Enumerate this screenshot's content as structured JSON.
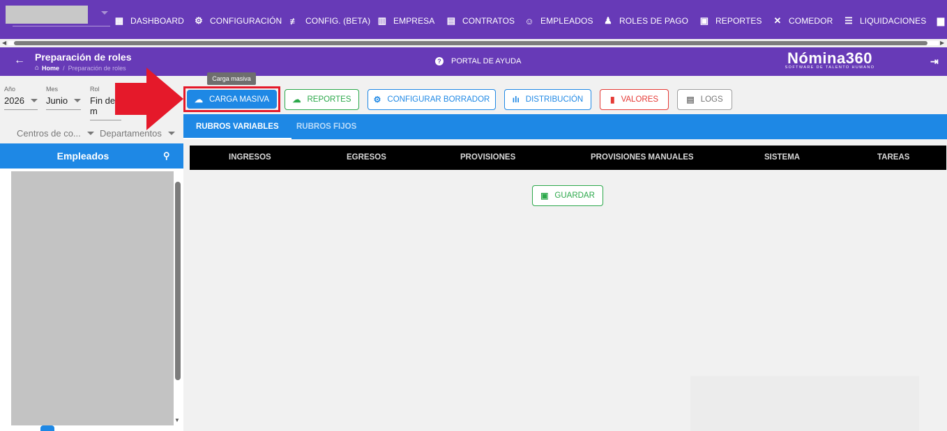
{
  "nav": [
    {
      "key": "dashboard",
      "label": "DASHBOARD",
      "icon": "dashboard-icon"
    },
    {
      "key": "configuracion",
      "label": "CONFIGURACIÓN",
      "icon": "gear-icon"
    },
    {
      "key": "config-beta",
      "label": "CONFIG. (BETA)",
      "icon": "sliders-icon"
    },
    {
      "key": "empresa",
      "label": "EMPRESA",
      "icon": "building-icon"
    },
    {
      "key": "contratos",
      "label": "CONTRATOS",
      "icon": "clipboard-icon"
    },
    {
      "key": "empleados",
      "label": "EMPLEADOS",
      "icon": "face-icon"
    },
    {
      "key": "roles-de-pago",
      "label": "ROLES DE PAGO",
      "icon": "people-icon"
    },
    {
      "key": "reportes",
      "label": "REPORTES",
      "icon": "report-icon"
    },
    {
      "key": "comedor",
      "label": "COMEDOR",
      "icon": "utensils-icon"
    },
    {
      "key": "liquidaciones",
      "label": "LIQUIDACIONES",
      "icon": "list-icon"
    }
  ],
  "header": {
    "title": "Preparación de roles",
    "breadcrumb_home": "Home",
    "breadcrumb_separator": "/",
    "breadcrumb_current": "Preparación de roles",
    "help_label": "PORTAL DE AYUDA",
    "brand_name": "Nómina360",
    "brand_tagline": "SOFTWARE DE TALENTO HUMANO"
  },
  "filters": {
    "year_label": "Año",
    "year_value": "2026",
    "month_label": "Mes",
    "month_value": "Junio",
    "role_label": "Rol",
    "role_value": "Fin de m",
    "cost_centers": "Centros de co...",
    "departments": "Departamentos"
  },
  "actions": {
    "tooltip": "Carga masiva",
    "carga_masiva": "CARGA MASIVA",
    "reportes": "REPORTES",
    "configurar_borrador": "CONFIGURAR BORRADOR",
    "distribucion": "DISTRIBUCIÓN",
    "valores": "VALORES",
    "logs": "LOGS"
  },
  "tabs": [
    "RUBROS VARIABLES",
    "RUBROS FIJOS"
  ],
  "subtabs": [
    "INGRESOS",
    "EGRESOS",
    "PROVISIONES",
    "PROVISIONES MANUALES",
    "SISTEMA",
    "TAREAS"
  ],
  "employees": {
    "title": "Empleados"
  },
  "save_label": "GUARDAR",
  "colors": {
    "nav_bg": "#673ab7",
    "primary": "#1e88e5",
    "success": "#2ba84a",
    "danger": "#e53935",
    "highlight_red": "#e5192a"
  }
}
